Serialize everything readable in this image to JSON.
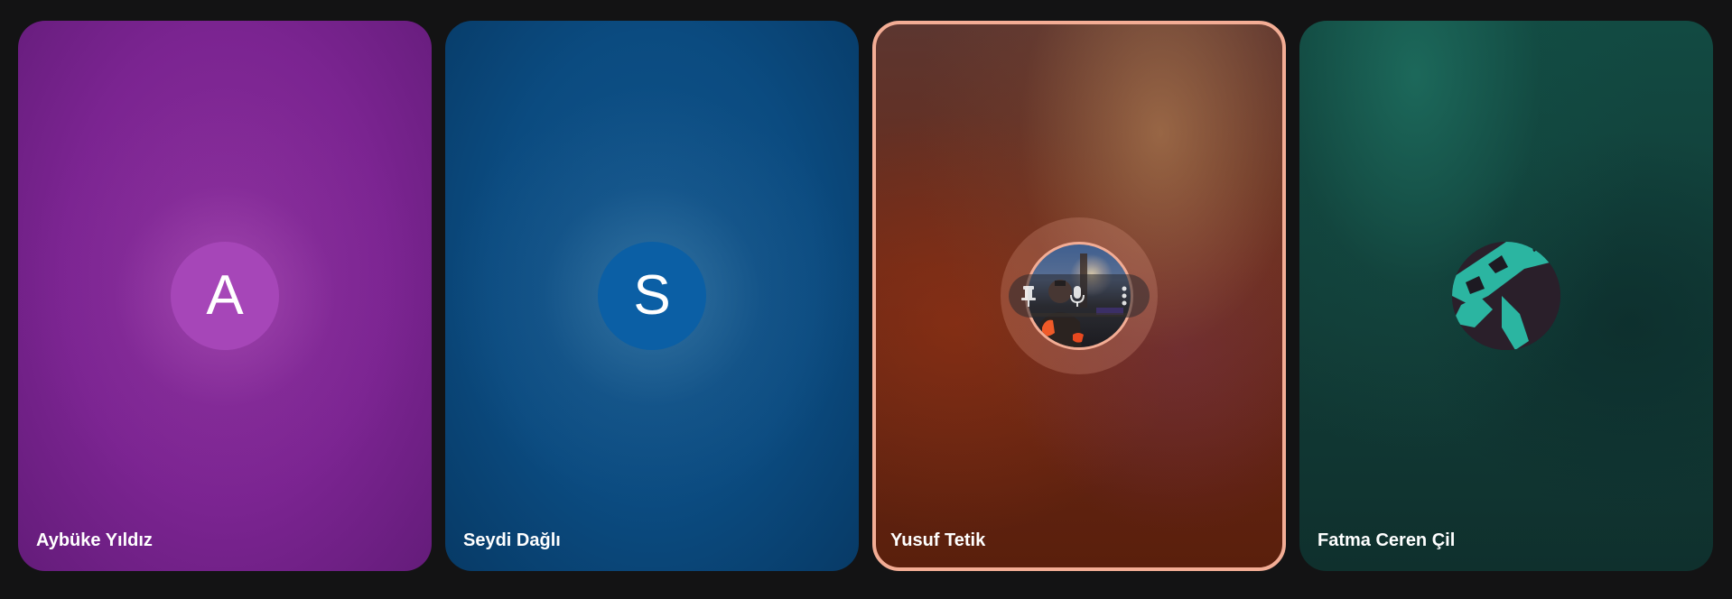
{
  "participants": [
    {
      "name": "Aybüke Yıldız",
      "avatar_type": "letter",
      "initial": "A",
      "avatar_color": "#a646b8",
      "tile_color": "#7b2491",
      "speaking": false
    },
    {
      "name": "Seydi Dağlı",
      "avatar_type": "letter",
      "initial": "S",
      "avatar_color": "#0b5fa5",
      "tile_color": "#0b4b80",
      "speaking": false
    },
    {
      "name": "Yusuf Tetik",
      "avatar_type": "photo",
      "avatar_icon": "person-photo",
      "tile_color": "#6b2a18",
      "highlight_color": "#f3ad95",
      "speaking": true,
      "hover_controls": [
        "pin-icon",
        "mic-icon",
        "more-vert-icon"
      ]
    },
    {
      "name": "Fatma Ceren Çil",
      "avatar_type": "image",
      "avatar_icon": "illustration-avatar",
      "avatar_color": "#2bb5a1",
      "tile_color": "#123d38",
      "speaking": false
    }
  ]
}
